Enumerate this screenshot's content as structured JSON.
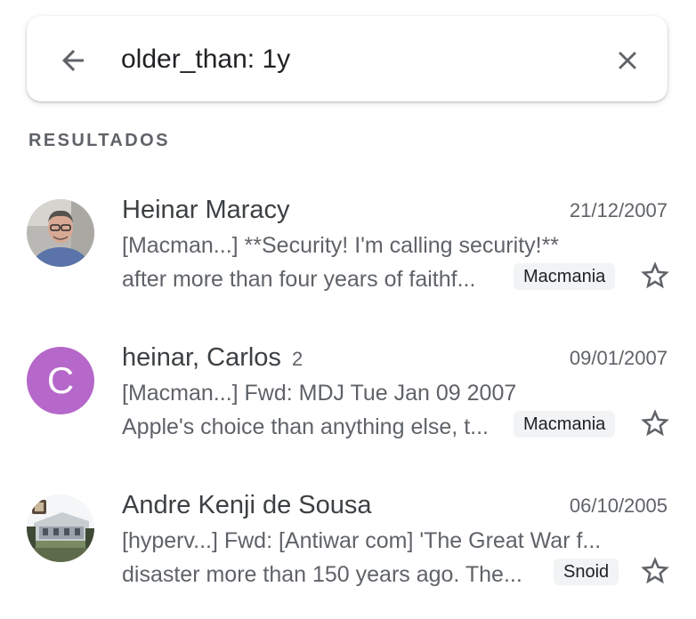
{
  "search": {
    "query": "older_than: 1y",
    "back_icon": "arrow-back-icon",
    "clear_icon": "close-icon"
  },
  "section": {
    "title": "RESULTADOS"
  },
  "colors": {
    "avatar_c_bg": "#b568c9",
    "chip_bg": "#f1f3f4",
    "text_secondary": "#5f6368"
  },
  "emails": [
    {
      "sender": "Heinar Maracy",
      "count": "",
      "date": "21/12/2007",
      "subject": "[Macman...] **Security! I'm calling security!**",
      "snippet": "after more than four years of faithf...",
      "label": "Macmania",
      "avatar": "photo-man-glasses",
      "starred": false
    },
    {
      "sender": "heinar, Carlos",
      "count": "2",
      "date": "09/01/2007",
      "subject": "[Macman...] Fwd: MDJ Tue Jan 09 2007",
      "snippet": "Apple's choice than anything else, t...",
      "label": "Macmania",
      "avatar_letter": "C",
      "starred": false
    },
    {
      "sender": "Andre Kenji de Sousa",
      "count": "",
      "date": "06/10/2005",
      "subject": "[hyperv...] Fwd: [Antiwar com] 'The Great War f...",
      "snippet": "disaster more than 150 years ago. The...",
      "label": "Snoid",
      "avatar": "photo-building",
      "starred": false
    }
  ]
}
